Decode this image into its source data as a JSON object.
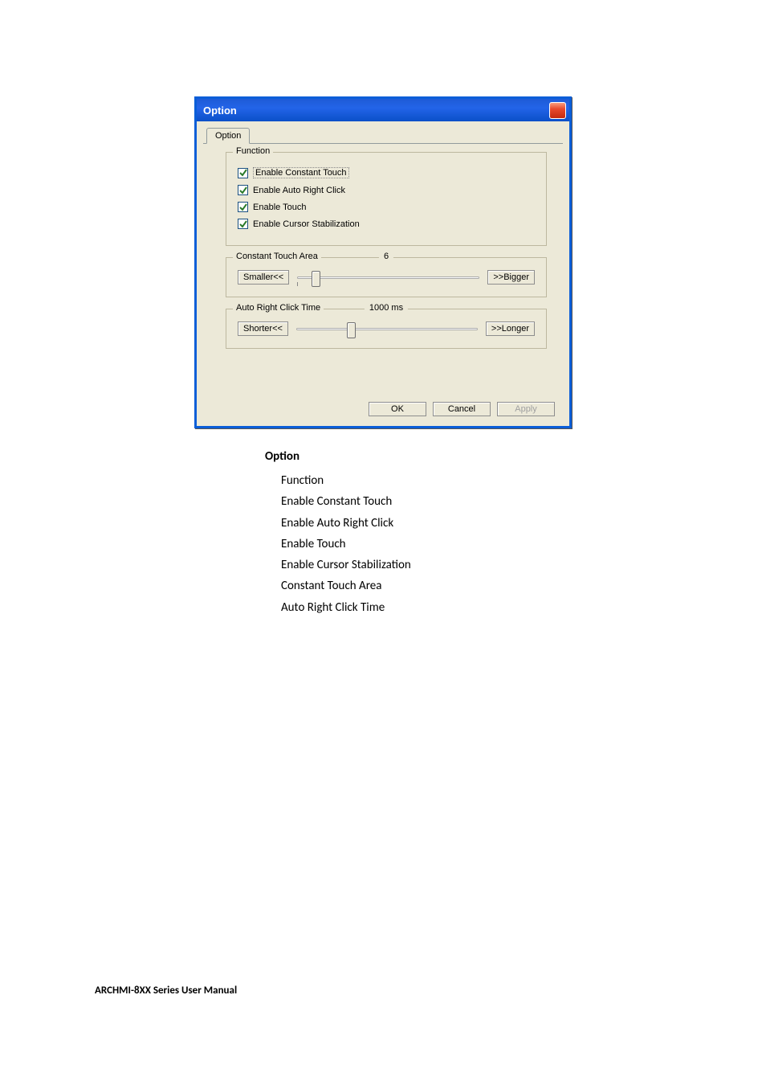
{
  "dialog": {
    "title": "Option",
    "tab": "Option",
    "function_group": {
      "title": "Function",
      "items": [
        {
          "label": "Enable Constant Touch",
          "checked": true,
          "focused": true
        },
        {
          "label": "Enable Auto Right Click",
          "checked": true,
          "focused": false
        },
        {
          "label": "Enable Touch",
          "checked": true,
          "focused": false
        },
        {
          "label": "Enable Cursor Stabilization",
          "checked": true,
          "focused": false
        }
      ]
    },
    "constant_touch": {
      "title": "Constant Touch Area",
      "value": "6",
      "smaller": "Smaller<<",
      "bigger": ">>Bigger"
    },
    "auto_right_click": {
      "title": "Auto Right Click Time",
      "value": "1000 ms",
      "shorter": "Shorter<<",
      "longer": ">>Longer"
    },
    "buttons": {
      "ok": "OK",
      "cancel": "Cancel",
      "apply": "Apply"
    }
  },
  "doc": {
    "heading": "Option",
    "lines": [
      "Function",
      "Enable Constant Touch",
      "Enable Auto Right Click",
      "Enable Touch",
      "Enable Cursor Stabilization",
      "Constant Touch Area",
      "Auto Right Click Time"
    ]
  },
  "footer": "ARCHMI-8XX Series User Manual"
}
